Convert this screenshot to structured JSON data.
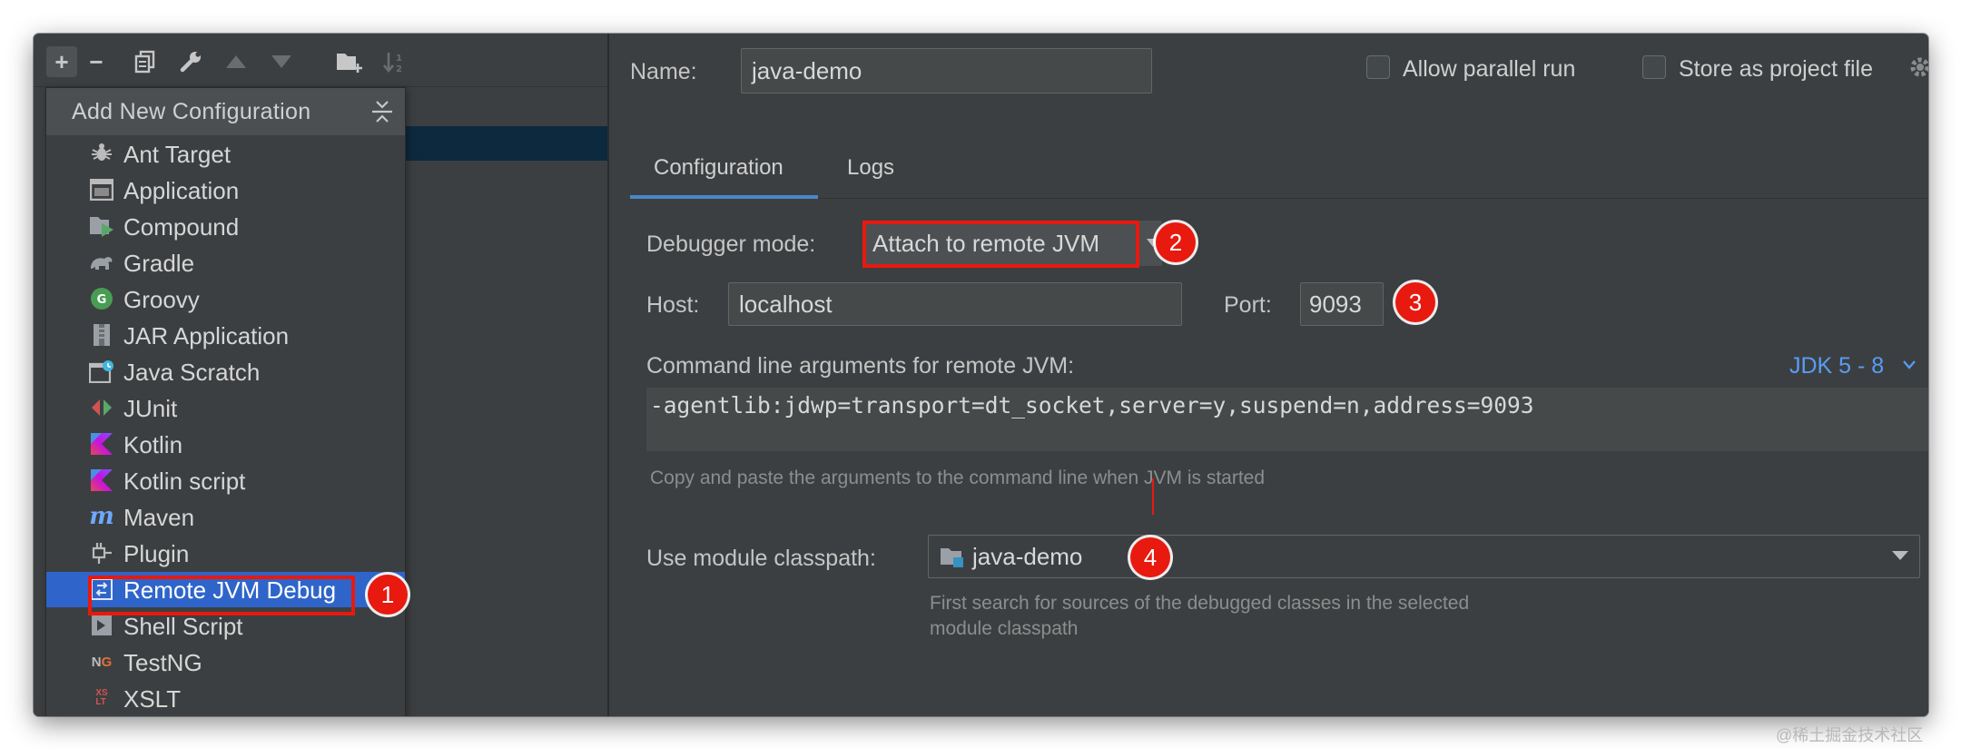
{
  "toolbar": {
    "icons": [
      "plus-icon",
      "minus-icon",
      "copy-icon",
      "wrench-icon",
      "move-up-icon",
      "move-down-icon",
      "new-folder-icon",
      "sort-icon"
    ]
  },
  "popup": {
    "title": "Add New Configuration",
    "items": [
      {
        "label": "Ant Target",
        "icon": "ant-icon"
      },
      {
        "label": "Application",
        "icon": "application-icon"
      },
      {
        "label": "Compound",
        "icon": "compound-icon"
      },
      {
        "label": "Gradle",
        "icon": "gradle-icon"
      },
      {
        "label": "Groovy",
        "icon": "groovy-icon"
      },
      {
        "label": "JAR Application",
        "icon": "jar-icon"
      },
      {
        "label": "Java Scratch",
        "icon": "java-scratch-icon"
      },
      {
        "label": "JUnit",
        "icon": "junit-icon"
      },
      {
        "label": "Kotlin",
        "icon": "kotlin-icon"
      },
      {
        "label": "Kotlin script",
        "icon": "kotlin-script-icon"
      },
      {
        "label": "Maven",
        "icon": "maven-icon"
      },
      {
        "label": "Plugin",
        "icon": "plugin-icon"
      },
      {
        "label": "Remote JVM Debug",
        "icon": "remote-debug-icon"
      },
      {
        "label": "Shell Script",
        "icon": "shell-script-icon"
      },
      {
        "label": "TestNG",
        "icon": "testng-icon"
      },
      {
        "label": "XSLT",
        "icon": "xslt-icon"
      }
    ],
    "selected": "Remote JVM Debug"
  },
  "header": {
    "name_label": "Name:",
    "name_value": "java-demo",
    "allow_parallel_label": "Allow parallel run",
    "store_project_label": "Store as project file"
  },
  "tabs": {
    "configuration": "Configuration",
    "logs": "Logs",
    "active": "Configuration"
  },
  "config": {
    "debugger_mode_label": "Debugger mode:",
    "debugger_mode_value": "Attach to remote JVM",
    "host_label": "Host:",
    "host_value": "localhost",
    "port_label": "Port:",
    "port_value": "9093",
    "cmd_label": "Command line arguments for remote JVM:",
    "jdk_link": "JDK 5 - 8",
    "cmd_value": "-agentlib:jdwp=transport=dt_socket,server=y,suspend=n,address=9093",
    "cmd_hint": "Copy and paste the arguments to the command line when JVM is started",
    "module_label": "Use module classpath:",
    "module_value": "java-demo",
    "module_hint_line1": "First search for sources of the debugged classes in the selected",
    "module_hint_line2": "module classpath"
  },
  "annotations": [
    "1",
    "2",
    "3",
    "4"
  ],
  "watermark": "@稀土掘金技术社区",
  "colors": {
    "panel_bg": "#3c3f41",
    "selection": "#2f65ca",
    "link": "#589df6",
    "annotation_red": "#e8190f"
  }
}
